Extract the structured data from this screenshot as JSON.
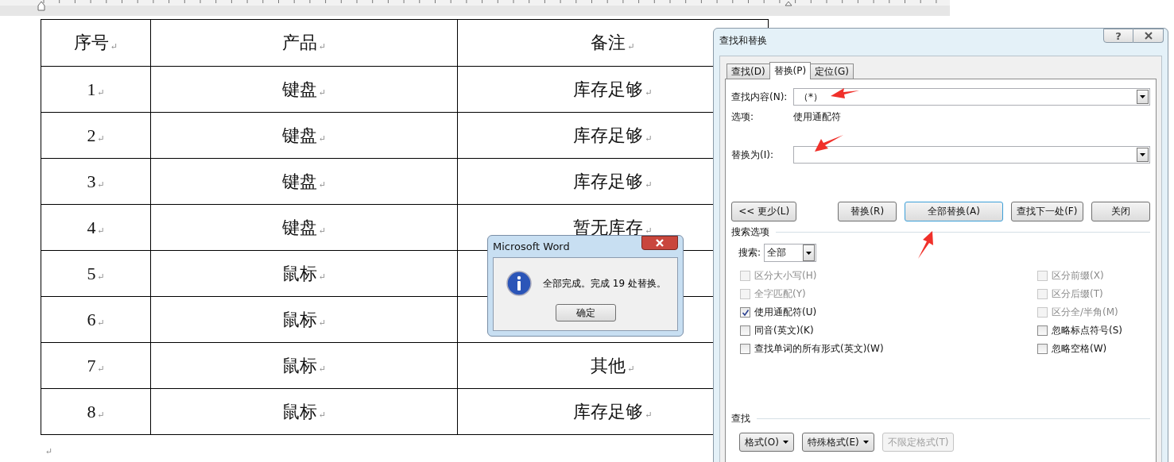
{
  "document": {
    "table": {
      "rows": [
        {
          "cells": [
            {
              "text": "序号",
              "mark": "↵"
            },
            {
              "text": "产品",
              "mark": "↵"
            },
            {
              "text": "备注",
              "mark": "↵"
            }
          ]
        },
        {
          "cells": [
            {
              "text": "1",
              "mark": "↵"
            },
            {
              "text": "键盘",
              "mark": "↵"
            },
            {
              "text": "库存足够",
              "mark": "↵"
            }
          ]
        },
        {
          "cells": [
            {
              "text": "2",
              "mark": "↵"
            },
            {
              "text": "键盘",
              "mark": "↵"
            },
            {
              "text": "库存足够",
              "mark": "↵"
            }
          ]
        },
        {
          "cells": [
            {
              "text": "3",
              "mark": "↵"
            },
            {
              "text": "键盘",
              "mark": "↵"
            },
            {
              "text": "库存足够",
              "mark": "↵"
            }
          ]
        },
        {
          "cells": [
            {
              "text": "4",
              "mark": "↵"
            },
            {
              "text": "键盘",
              "mark": "↵"
            },
            {
              "text": "暂无库存",
              "mark": "↵"
            }
          ]
        },
        {
          "cells": [
            {
              "text": "5",
              "mark": "↵"
            },
            {
              "text": "鼠标",
              "mark": "↵"
            }
          ]
        },
        {
          "cells": [
            {
              "text": "6",
              "mark": "↵"
            },
            {
              "text": "鼠标",
              "mark": "↵"
            }
          ]
        },
        {
          "cells": [
            {
              "text": "7",
              "mark": "↵"
            },
            {
              "text": "鼠标",
              "mark": "↵"
            },
            {
              "text": "其他",
              "mark": "↵"
            }
          ]
        },
        {
          "cells": [
            {
              "text": "8",
              "mark": "↵"
            },
            {
              "text": "鼠标",
              "mark": "↵"
            },
            {
              "text": "库存足够",
              "mark": "↵"
            }
          ]
        }
      ]
    },
    "end_mark": "↵"
  },
  "find_dialog": {
    "title": "查找和替换",
    "help": "?",
    "tabs": [
      {
        "label": "查找(D)",
        "selected": false
      },
      {
        "label": "替换(P)",
        "selected": true
      },
      {
        "label": "定位(G)",
        "selected": false
      }
    ],
    "find_what": {
      "label": "查找内容(N):",
      "value": "（*）"
    },
    "options": {
      "label": "选项:",
      "value": "使用通配符"
    },
    "replace_with": {
      "label": "替换为(I):"
    },
    "buttons": [
      {
        "label": "<< 更少(L)",
        "default": false
      },
      {
        "label": "替换(R)",
        "default": false
      },
      {
        "label": "全部替换(A)",
        "default": true
      },
      {
        "label": "查找下一处(F)",
        "default": false
      },
      {
        "label": "关闭",
        "default": false
      }
    ],
    "search_options": {
      "heading": "搜索选项",
      "search_label": "搜索:",
      "search_value": "全部",
      "left": [
        {
          "label": "区分大小写(H)",
          "checked": false,
          "disabled": true
        },
        {
          "label": "全字匹配(Y)",
          "checked": false,
          "disabled": true
        },
        {
          "label": "使用通配符(U)",
          "checked": true,
          "disabled": false
        },
        {
          "label": "同音(英文)(K)",
          "checked": false,
          "disabled": false
        },
        {
          "label": "查找单词的所有形式(英文)(W)",
          "checked": false,
          "disabled": false
        }
      ],
      "right": [
        {
          "label": "区分前缀(X)",
          "checked": false,
          "disabled": true
        },
        {
          "label": "区分后缀(T)",
          "checked": false,
          "disabled": true
        },
        {
          "label": "区分全/半角(M)",
          "checked": false,
          "disabled": true
        },
        {
          "label": "忽略标点符号(S)",
          "checked": false,
          "disabled": false
        },
        {
          "label": "忽略空格(W)",
          "checked": false,
          "disabled": false
        }
      ]
    },
    "find_section": {
      "heading": "查找",
      "buttons": [
        {
          "label": "格式(O)",
          "dropdown": true,
          "disabled": false
        },
        {
          "label": "特殊格式(E)",
          "dropdown": true,
          "disabled": false
        },
        {
          "label": "不限定格式(T)",
          "dropdown": false,
          "disabled": true
        }
      ]
    }
  },
  "message_box": {
    "title": "Microsoft Word",
    "message": "全部完成。完成 19 处替换。",
    "ok": "确定"
  }
}
